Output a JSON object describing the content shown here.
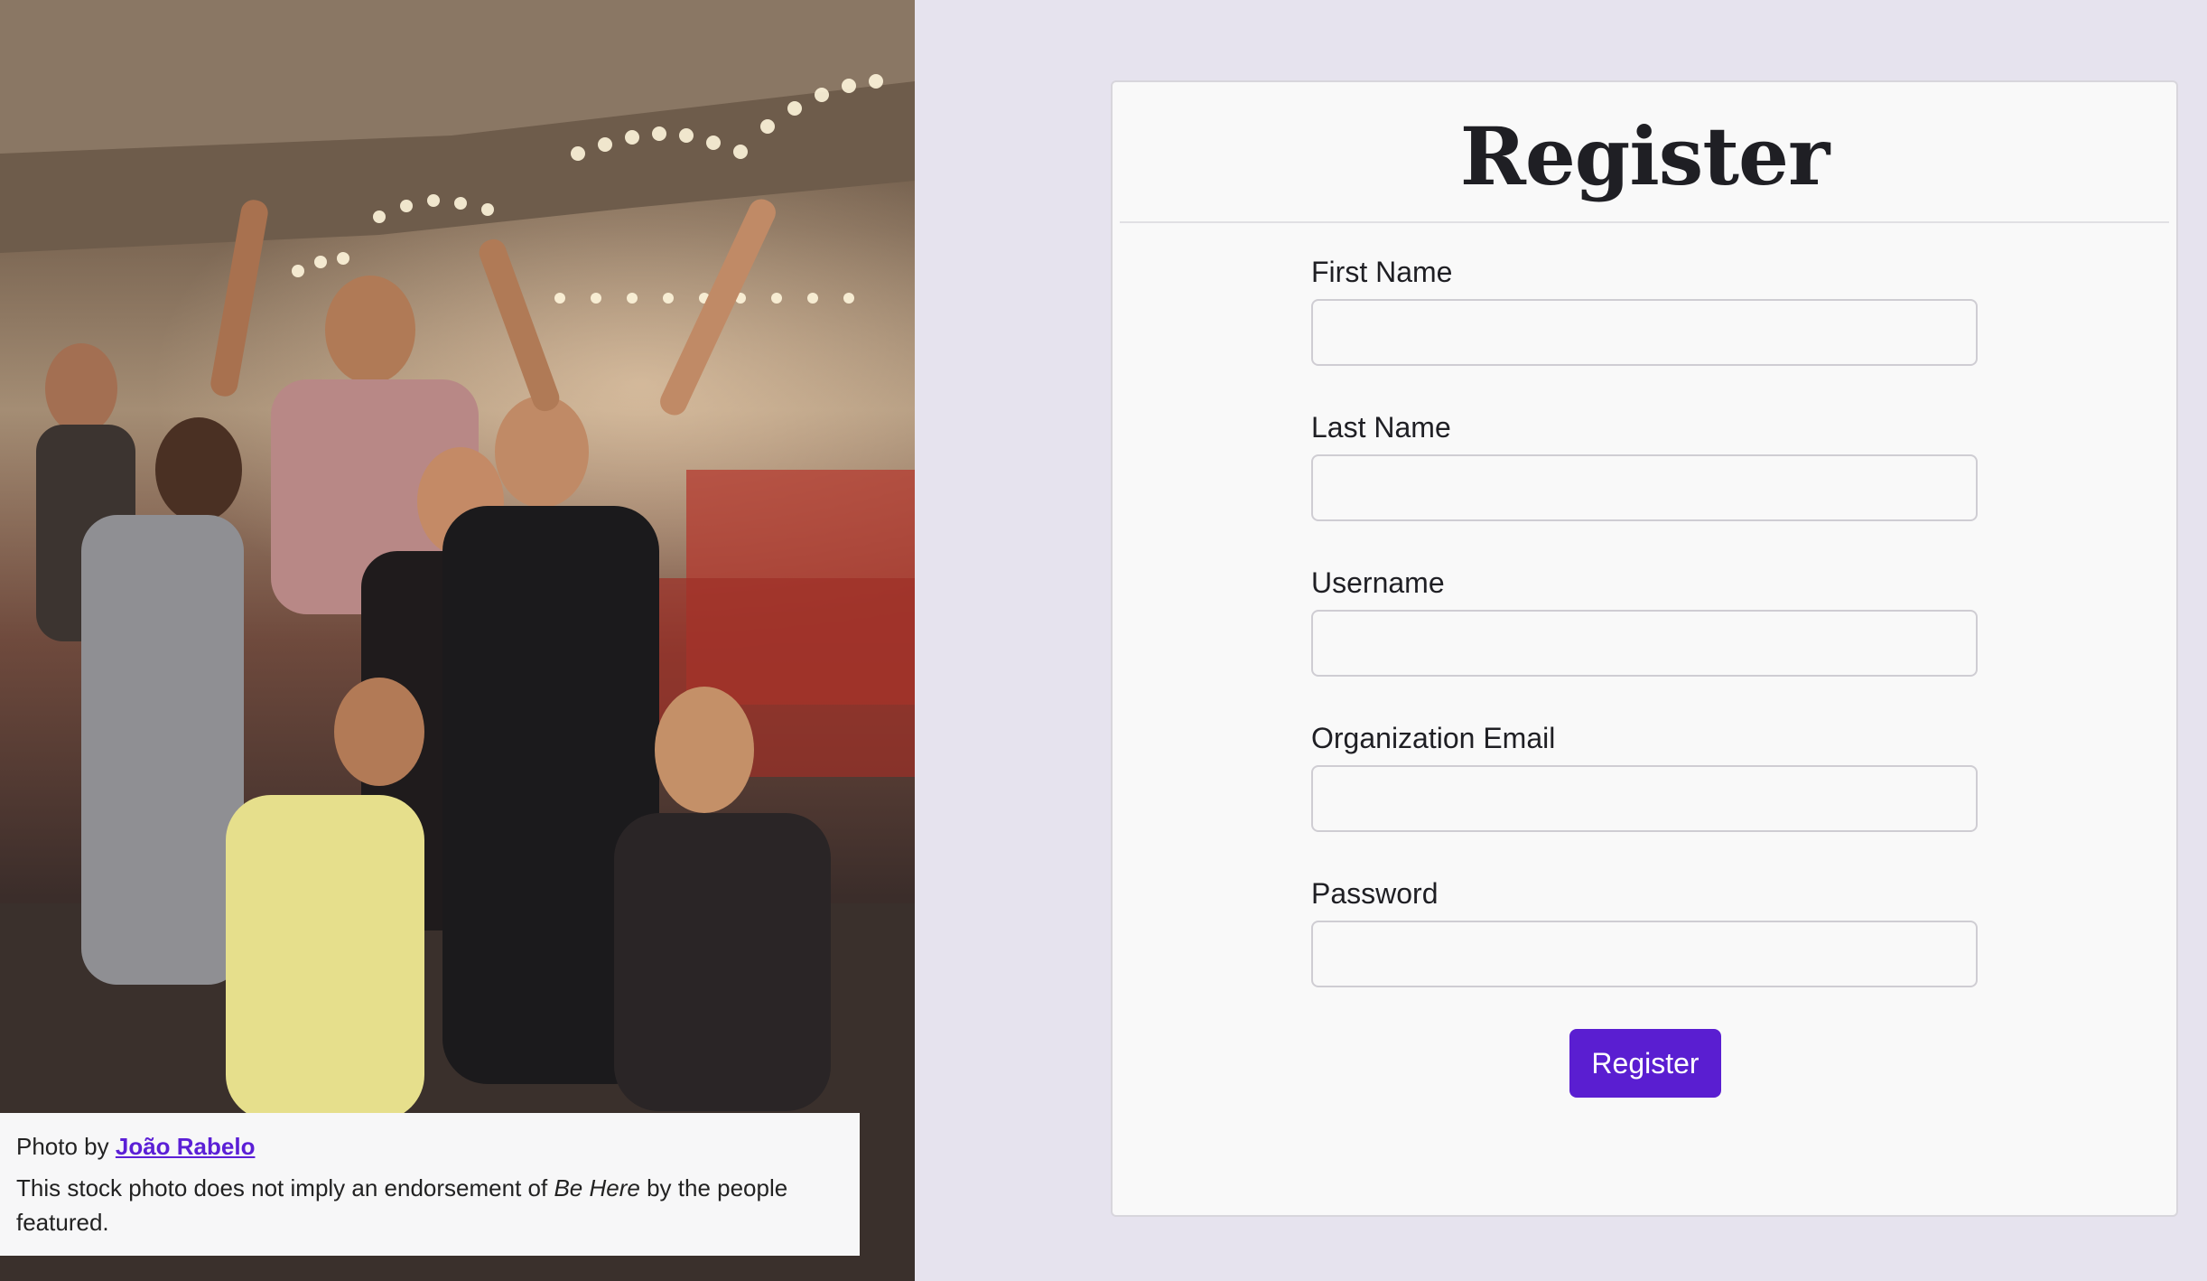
{
  "photo": {
    "alt": "Group of young people posing and smiling at a fairground at night",
    "credit_prefix": "Photo by",
    "credit_name": "João Rabelo",
    "disclaimer_before": "This stock photo does not imply an endorsement of",
    "disclaimer_emphasis": "Be Here",
    "disclaimer_after": "by the people featured."
  },
  "form": {
    "title": "Register",
    "fields": [
      {
        "label": "First Name",
        "value": ""
      },
      {
        "label": "Last Name",
        "value": ""
      },
      {
        "label": "Username",
        "value": ""
      },
      {
        "label": "Organization Email",
        "value": ""
      },
      {
        "label": "Password",
        "value": ""
      }
    ],
    "submit_label": "Register"
  },
  "colors": {
    "accent": "#5a1ed1",
    "link": "#5b1fd6",
    "page_background": "#e6e3ee",
    "card_background": "#f9f9f9"
  }
}
